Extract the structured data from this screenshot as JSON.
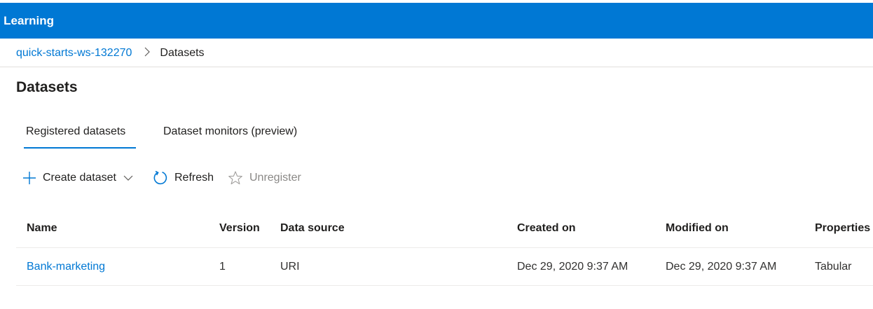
{
  "header": {
    "title": "e Learning"
  },
  "breadcrumb": {
    "workspace": "quick-starts-ws-132270",
    "current": "Datasets"
  },
  "page": {
    "title": "Datasets"
  },
  "tabs": [
    {
      "label": "Registered datasets",
      "active": true
    },
    {
      "label": "Dataset monitors (preview)",
      "active": false
    }
  ],
  "toolbar": {
    "create_label": "Create dataset",
    "create_icon": "plus-icon",
    "dropdown_icon": "chevron-down-icon",
    "refresh_label": "Refresh",
    "refresh_icon": "refresh-icon",
    "unregister_label": "Unregister",
    "unregister_icon": "star-outline-icon"
  },
  "table": {
    "columns": [
      "Name",
      "Version",
      "Data source",
      "Created on",
      "Modified on",
      "Properties"
    ],
    "rows": [
      [
        "Bank-marketing",
        "1",
        "URI",
        "Dec 29, 2020 9:37 AM",
        "Dec 29, 2020 9:37 AM",
        "Tabular"
      ]
    ]
  },
  "colors": {
    "brand_blue": "#0078d4",
    "text": "#201f1e",
    "disabled_text": "#8a8886",
    "divider": "#e1dfdd"
  }
}
